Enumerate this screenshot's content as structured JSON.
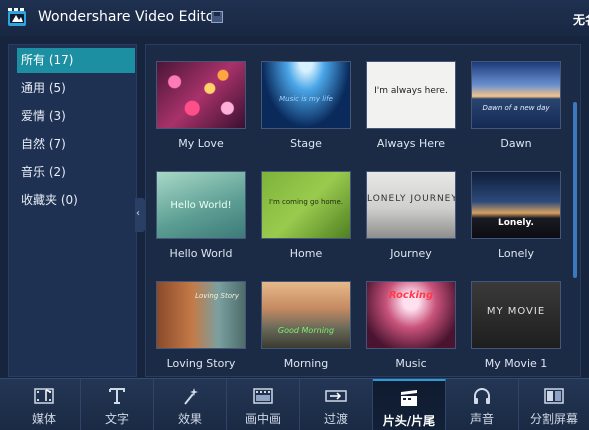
{
  "app": {
    "title": "Wondershare Video Editor",
    "project_name": "无名"
  },
  "sidebar": {
    "categories": [
      {
        "label": "所有 (17)",
        "active": true
      },
      {
        "label": "通用 (5)",
        "active": false
      },
      {
        "label": "爱情 (3)",
        "active": false
      },
      {
        "label": "自然 (7)",
        "active": false
      },
      {
        "label": "音乐 (2)",
        "active": false
      },
      {
        "label": "收藏夹 (0)",
        "active": false
      }
    ]
  },
  "templates": [
    {
      "name": "My Love"
    },
    {
      "name": "Stage",
      "overlay": "Music is my life"
    },
    {
      "name": "Always Here",
      "overlay": "I'm always here."
    },
    {
      "name": "Dawn",
      "overlay": "Dawn of a new day"
    },
    {
      "name": "Hello World",
      "overlay": "Hello World!"
    },
    {
      "name": "Home",
      "overlay": "I'm coming go home."
    },
    {
      "name": "Journey",
      "overlay": "LONELY JOURNEY"
    },
    {
      "name": "Lonely",
      "overlay": "Lonely."
    },
    {
      "name": "Loving Story",
      "overlay": "Loving Story"
    },
    {
      "name": "Morning",
      "overlay": "Good Morning"
    },
    {
      "name": "Music",
      "overlay": "Rocking"
    },
    {
      "name": "My Movie 1",
      "overlay": "MY MOVIE"
    }
  ],
  "toolbar": {
    "tabs": [
      {
        "label": "媒体",
        "icon": "media-icon"
      },
      {
        "label": "文字",
        "icon": "text-icon"
      },
      {
        "label": "效果",
        "icon": "effects-icon"
      },
      {
        "label": "画中画",
        "icon": "pip-icon"
      },
      {
        "label": "过渡",
        "icon": "transition-icon"
      },
      {
        "label": "片头/片尾",
        "icon": "intro-credit-icon",
        "active": true
      },
      {
        "label": "声音",
        "icon": "headphones-icon"
      },
      {
        "label": "分割屏幕",
        "icon": "split-screen-icon"
      }
    ]
  },
  "colors": {
    "accent": "#1c8fa3",
    "active_tab_border": "#2b9bd8"
  }
}
